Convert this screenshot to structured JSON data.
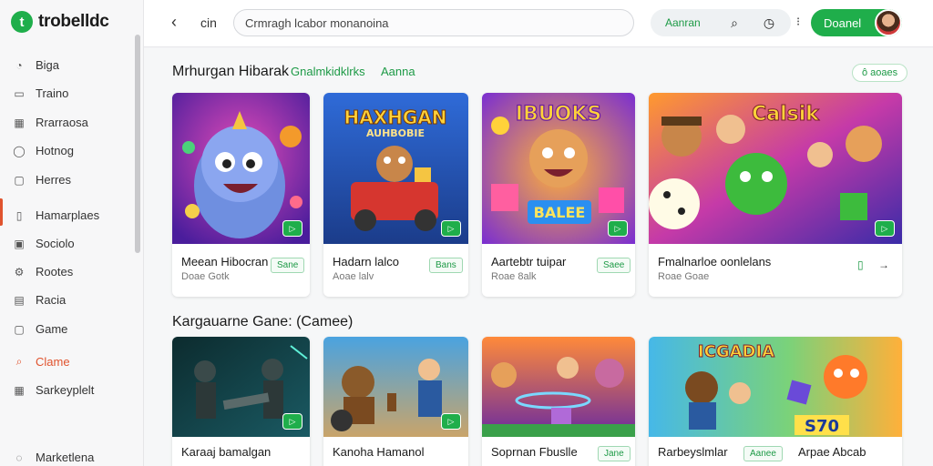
{
  "brand": {
    "logo_letter": "t",
    "name": "trobelldc"
  },
  "sidebar": {
    "items": [
      {
        "label": "Biga",
        "icon": "pie-chart-icon",
        "glyph": "◔"
      },
      {
        "label": "Traino",
        "icon": "monitor-icon",
        "glyph": "▭"
      },
      {
        "label": "Rrarraosa",
        "icon": "calendar-icon",
        "glyph": "▦"
      },
      {
        "label": "Hotnog",
        "icon": "chat-icon",
        "glyph": "◯"
      },
      {
        "label": "Herres",
        "icon": "folder-icon",
        "glyph": "▢"
      },
      {
        "label": "Hamarplaes",
        "icon": "gamepad-icon",
        "glyph": "▯"
      },
      {
        "label": "Sociolo",
        "icon": "grid-icon",
        "glyph": "▣"
      },
      {
        "label": "Rootes",
        "icon": "settings-icon",
        "glyph": "⚙"
      },
      {
        "label": "Racia",
        "icon": "photo-icon",
        "glyph": "▤"
      },
      {
        "label": "Game",
        "icon": "document-icon",
        "glyph": "▢"
      },
      {
        "label": "Clame",
        "icon": "search-icon",
        "glyph": "⌕"
      },
      {
        "label": "Sarkeyplelt",
        "icon": "apps-icon",
        "glyph": "▦"
      },
      {
        "label": "Marketlena",
        "icon": "store-icon",
        "glyph": "◌"
      }
    ],
    "active_index": 10
  },
  "topbar": {
    "back_glyph": "‹",
    "label": "cin",
    "search_value": "Crmragh lcabor monanoina",
    "pill_label": "Aanran",
    "search_icon": "⌕",
    "clock_icon": "◷",
    "dots": "⁝",
    "cta_label": "Doanel"
  },
  "sections": [
    {
      "title": "Mrhurgan Hibarak",
      "link": "Gnalmkidklrks",
      "link2": "Aanna",
      "tag": "ô aoaes"
    },
    {
      "title": "Kargauarne Gane: (Camee)"
    }
  ],
  "cards_row1": [
    {
      "title": "Meean Hibocran",
      "sub": "Doae Gotk",
      "badge": "Sane",
      "play": "▷"
    },
    {
      "title": "Hadarn lalco",
      "sub": "Aoae lalv",
      "badge": "Bans",
      "play": "▷"
    },
    {
      "title": "Aartebtr tuipar",
      "sub": "Roae 8alk",
      "badge": "Saee",
      "play": "▷"
    },
    {
      "title": "Fmalnarloe oonlelans",
      "sub": "Roae Goae",
      "badge": "",
      "play": "▷",
      "icon1": "▯",
      "icon2": "→"
    }
  ],
  "cards_row2": [
    {
      "title": "Karaaj bamalgan",
      "sub": "",
      "play": "▷"
    },
    {
      "title": "Kanoha Hamanol",
      "sub": "",
      "play": "▷"
    },
    {
      "title": "Soprnan Fbuslle",
      "sub": "",
      "badge": "Jane"
    },
    {
      "title": "Rarbeyslmlar",
      "sub": "",
      "badge": "Aanee",
      "title2": "Arpae Abcab"
    }
  ],
  "thumb_text": {
    "card2": [
      "HAXHGAN",
      "AUHBOBIE"
    ],
    "card3": [
      "IBUOKS",
      "BALEE"
    ],
    "card4": [
      "Calsik"
    ],
    "card8": [
      "ICGADIA",
      "S70"
    ]
  },
  "colors": {
    "accent": "#1fae4b",
    "active": "#e0532e"
  }
}
